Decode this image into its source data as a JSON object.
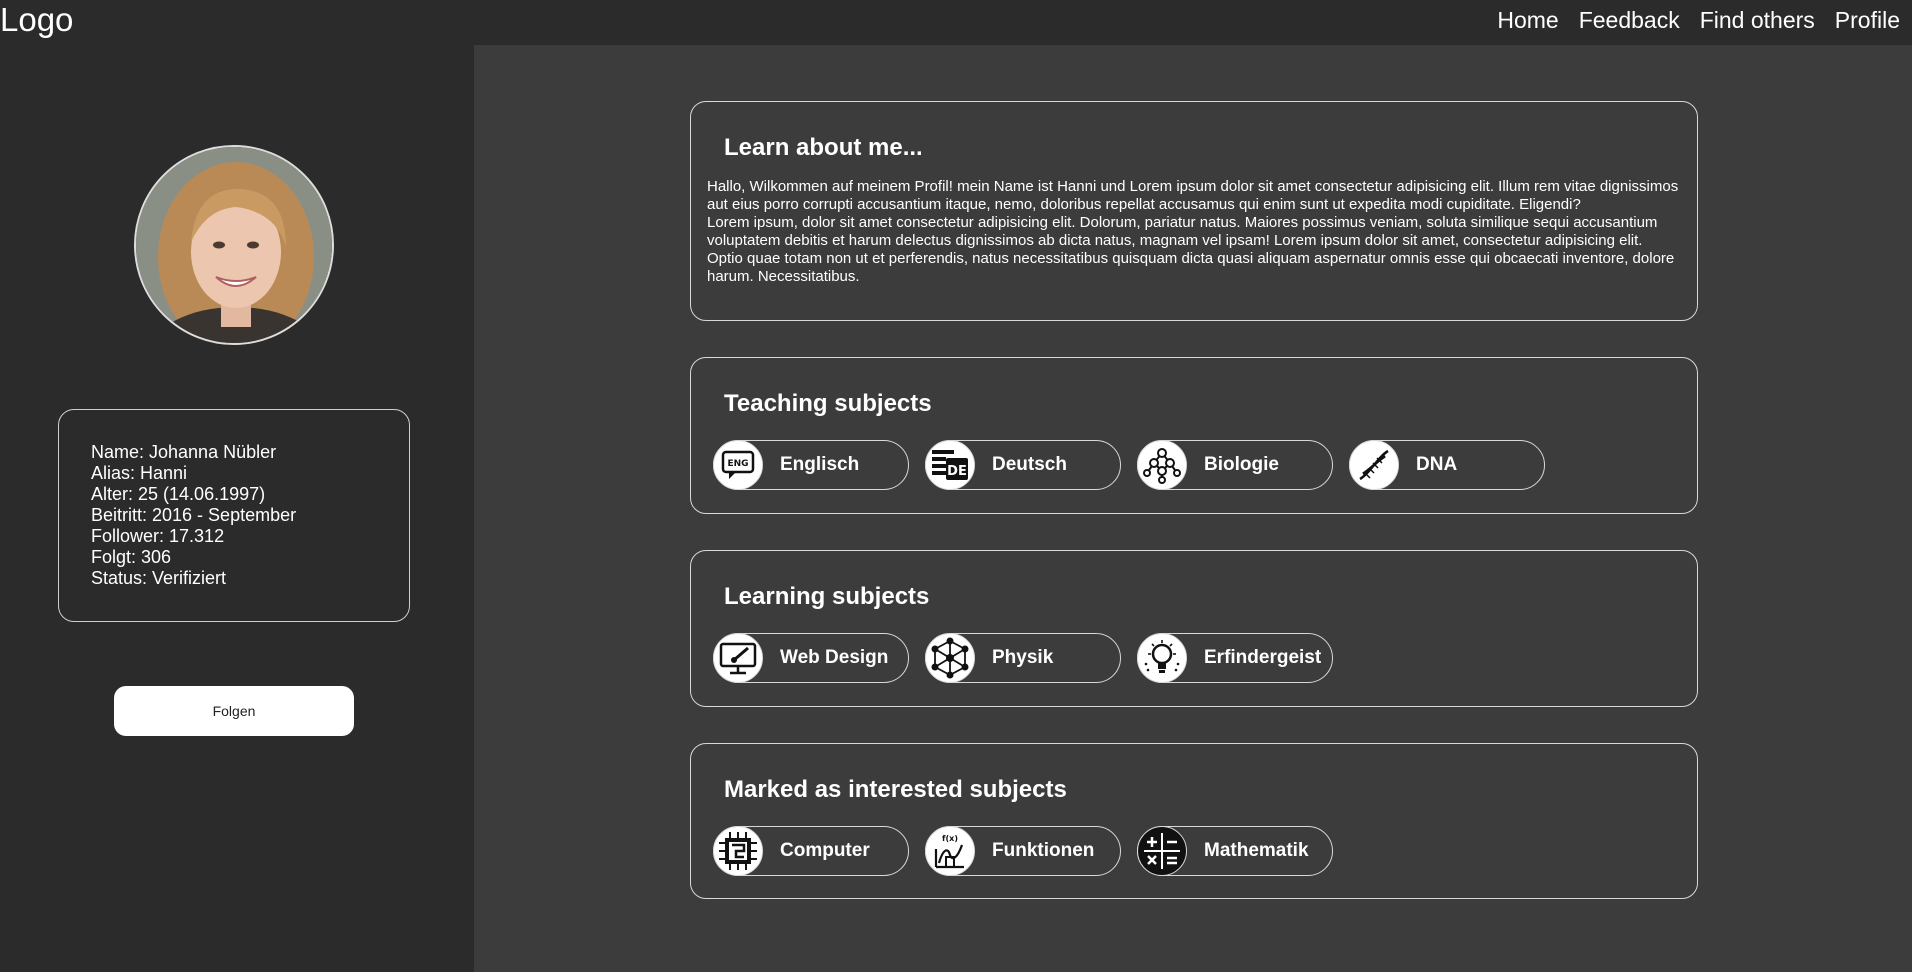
{
  "header": {
    "logo": "Logo",
    "nav": [
      "Home",
      "Feedback",
      "Find others",
      "Profile"
    ]
  },
  "profile": {
    "info": [
      "Name: Johanna Nübler",
      "Alias: Hanni",
      "Alter: 25 (14.06.1997)",
      "Beitritt: 2016 - September",
      "Follower: 17.312",
      "Folgt: 306",
      "Status: Verifiziert"
    ],
    "follow_label": "Folgen"
  },
  "about": {
    "title": "Learn about me...",
    "text": "Hallo, Wilkommen auf meinem Profil! mein Name ist Hanni und Lorem ipsum dolor sit amet consectetur adipisicing elit. Illum rem vitae dignissimos aut eius porro corrupti accusantium itaque, nemo, doloribus repellat accusamus qui enim sunt ut expedita modi cupiditate. Eligendi?\nLorem ipsum, dolor sit amet consectetur adipisicing elit. Dolorum, pariatur natus. Maiores possimus veniam, soluta similique sequi accusantium voluptatem debitis et harum delectus dignissimos ab dicta natus, magnam vel ipsam! Lorem ipsum dolor sit amet, consectetur adipisicing elit. Optio quae totam non ut et perferendis, natus necessitatibus quisquam dicta quasi aliquam aspernatur omnis esse qui obcaecati inventore, dolore harum. Necessitatibus."
  },
  "teaching": {
    "title": "Teaching subjects",
    "subjects": [
      {
        "label": "Englisch",
        "icon": "eng-speech-icon",
        "icon_text": "ENG"
      },
      {
        "label": "Deutsch",
        "icon": "de-document-icon",
        "icon_text": "DE"
      },
      {
        "label": "Biologie",
        "icon": "molecule-icon"
      },
      {
        "label": "DNA",
        "icon": "dna-icon"
      }
    ]
  },
  "learning": {
    "title": "Learning subjects",
    "subjects": [
      {
        "label": "Web Design",
        "icon": "monitor-pen-icon"
      },
      {
        "label": "Physik",
        "icon": "atom-network-icon"
      },
      {
        "label": "Erfindergeist",
        "icon": "lightbulb-icon"
      }
    ]
  },
  "interested": {
    "title": "Marked as interested subjects",
    "subjects": [
      {
        "label": "Computer",
        "icon": "chip-icon"
      },
      {
        "label": "Funktionen",
        "icon": "function-graph-icon",
        "icon_text": "f(x)"
      },
      {
        "label": "Mathematik",
        "icon": "math-operators-icon"
      }
    ]
  }
}
